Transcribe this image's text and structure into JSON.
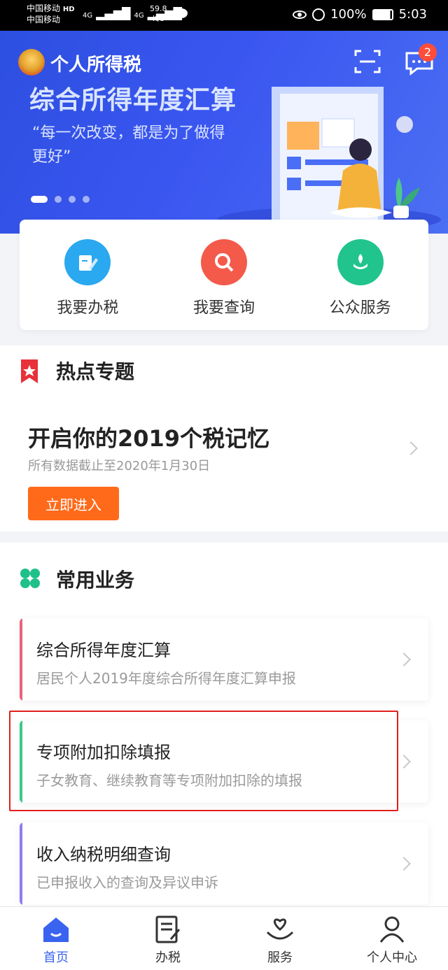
{
  "status_bar": {
    "carrier_1": "中国移动",
    "carrier_2": "中国移动",
    "hd": "HD",
    "net_1": "4G",
    "net_2": "4G",
    "speed_value": "59.8",
    "speed_unit": "K/s",
    "battery": "100%",
    "time": "5:03"
  },
  "header": {
    "app_title": "个人所得税",
    "message_badge": "2"
  },
  "banner": {
    "headline": "综合所得年度汇算",
    "quote": "“每一次改变，都是为了做得更好”",
    "pages": 4,
    "active_page": 1
  },
  "quick_actions": [
    {
      "label": "我要办税",
      "icon": "pencil-note-icon",
      "color": "#2aa8f0"
    },
    {
      "label": "我要查询",
      "icon": "magnifier-icon",
      "color": "#f45a4a"
    },
    {
      "label": "公众服务",
      "icon": "flower-hand-icon",
      "color": "#20c48c"
    }
  ],
  "hot_topic": {
    "section_title": "热点专题",
    "headline": "开启你的2019个税记忆",
    "subtitle": "所有数据截止至2020年1月30日",
    "button": "立即进入"
  },
  "common_services": {
    "section_title": "常用业务",
    "items": [
      {
        "title": "综合所得年度汇算",
        "subtitle": "居民个人2019年度综合所得年度汇算申报",
        "accent": "#e8627c"
      },
      {
        "title": "专项附加扣除填报",
        "subtitle": "子女教育、继续教育等专项附加扣除的填报",
        "accent": "#3cc98a"
      },
      {
        "title": "收入纳税明细查询",
        "subtitle": "已申报收入的查询及异议申诉",
        "accent": "#8e7cf0"
      }
    ]
  },
  "tab_bar": [
    {
      "label": "首页",
      "icon": "home-icon",
      "active": true
    },
    {
      "label": "办税",
      "icon": "document-edit-icon",
      "active": false
    },
    {
      "label": "服务",
      "icon": "heart-hands-icon",
      "active": false
    },
    {
      "label": "个人中心",
      "icon": "person-icon",
      "active": false
    }
  ],
  "colors": {
    "brand_blue": "#3a56f0",
    "orange": "#ff6a1a",
    "highlight_red": "#e0201b"
  }
}
